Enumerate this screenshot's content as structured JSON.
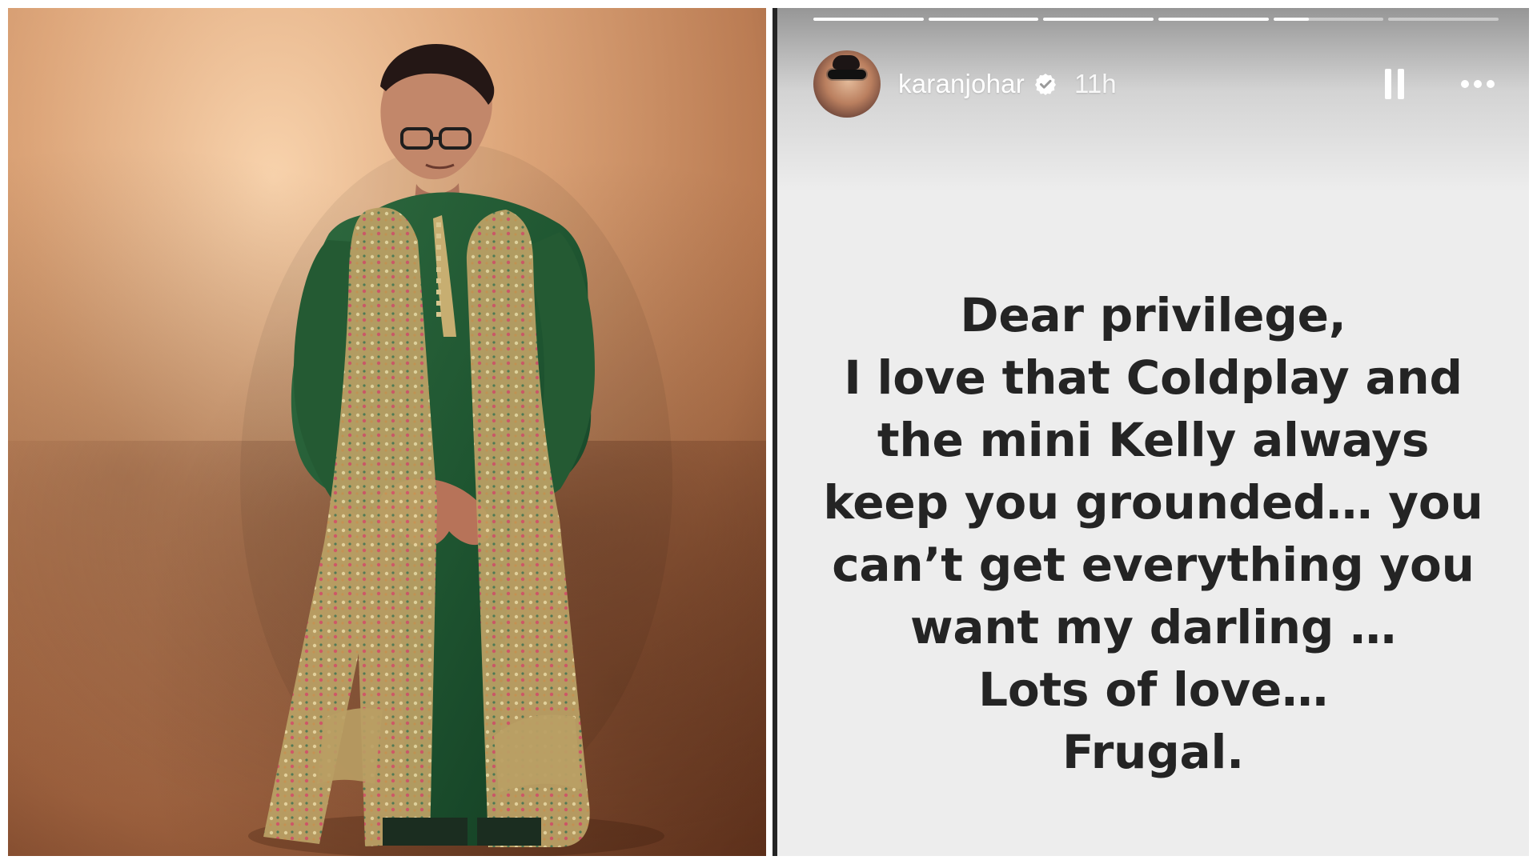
{
  "left_photo": {
    "alt": ""
  },
  "story": {
    "progress_segments": [
      1,
      1,
      1,
      1,
      0.32,
      0
    ],
    "username": "karanjohar",
    "time": "11h",
    "text_lines": [
      "Dear privilege,",
      "I love that Coldplay and",
      "the mini Kelly  always",
      "keep you grounded… you",
      "can’t get everything you",
      "want my darling …",
      "Lots of love…",
      "Frugal."
    ],
    "colors": {
      "story_background": "#ededed",
      "story_text": "#242424",
      "header_text": "#ffffff",
      "verified_badge": "#ffffff"
    },
    "icons": {
      "verified": "verified-badge-icon",
      "pause": "pause-icon",
      "more": "more-options-icon"
    }
  }
}
